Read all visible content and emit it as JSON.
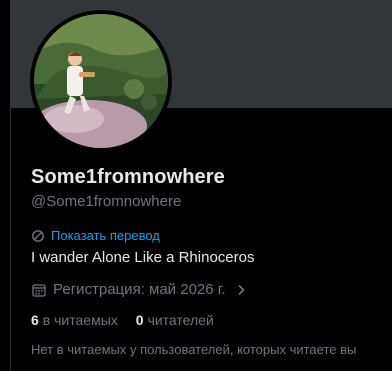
{
  "profile": {
    "display_name": "Some1fromnowhere",
    "handle": "@Some1fromnowhere",
    "translate_label": "Показать перевод",
    "bio": "I wander Alone Like a Rhinoceros",
    "joined": "Регистрация: май 2026 г.",
    "following_count": "6",
    "following_label": "в читаемых",
    "followers_count": "0",
    "followers_label": "читателей",
    "followers_you_know_note": "Нет в читаемых у пользователей, которых читаете вы"
  },
  "icons": {
    "translate": "translate-globe-icon",
    "calendar": "calendar-icon",
    "chevron": "chevron-right-icon"
  },
  "colors": {
    "background": "#000000",
    "banner": "#333639",
    "text_primary": "#e7e9ea",
    "text_secondary": "#71767b",
    "accent": "#1d9bf0"
  }
}
